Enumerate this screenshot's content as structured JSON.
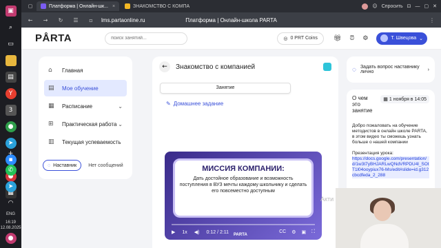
{
  "taskbar": {
    "time": "16:19",
    "date": "12.08.2025",
    "lang": "ENG"
  },
  "browser": {
    "tabs": [
      {
        "label": "Платформа | Онлайн-шк...",
        "active": true
      },
      {
        "label": "ЗНАКОМСТВО С КОМПА",
        "active": false
      }
    ],
    "ask_label": "Спросить",
    "url": "lms.partaonline.ru",
    "page_title": "Платформа | Онлайн-школа PARTA"
  },
  "header": {
    "logo": "PÅRTA",
    "search_placeholder": "поиск занятий...",
    "coins": "0 PRT Coins",
    "user": "Т. Швецова"
  },
  "nav": {
    "items": [
      {
        "label": "Главная",
        "icon": "home-icon"
      },
      {
        "label": "Мое обучение",
        "icon": "book-icon",
        "active": true
      },
      {
        "label": "Расписание",
        "icon": "calendar-icon",
        "chevron": true
      },
      {
        "label": "Практическая работа",
        "icon": "tasks-icon",
        "chevron": true
      },
      {
        "label": "Текущая успеваемость",
        "icon": "grades-icon"
      }
    ],
    "mentor_label": "Наставник",
    "no_messages": "Нет сообщений"
  },
  "main": {
    "title": "Знакомство с компанией",
    "lesson_tab": "Занятие",
    "homework": "Домашнее задание",
    "slide_title": "МИССИЯ КОМПАНИИ:",
    "slide_text": "Дать достойное образование и возможность поступления в ВУЗ мечты каждому школьнику и сделать его повсеместно доступным",
    "video_speed": "1x",
    "video_time": "0:12 / 2:11",
    "brand": "PARTA"
  },
  "right": {
    "ask": "Задать вопрос наставнику лично",
    "about_title": "О чем это занятие",
    "date": "1 ноября в 14:05",
    "description": "Добро пожаловать на обучение методистов в онлайн школе PARTA, в этом видео ты сможешь узнать больше о нашей компании",
    "presentation_label": "Презентация урока:",
    "presentation_link": "https://docs.google.com/presentation/d/1w3t7yBHJARLwQNdVRPDU4l_SOtT1l04ooypiux76-Ms/edit#slide=id.g312cbcdfeda_2_288"
  },
  "overlay": {
    "watermark": "Акти"
  },
  "colors": {
    "accent": "#3a50d9",
    "teal": "#2ec4d9",
    "nav_active": "#e3e9ff",
    "video_bg": "#5a4bb5"
  }
}
